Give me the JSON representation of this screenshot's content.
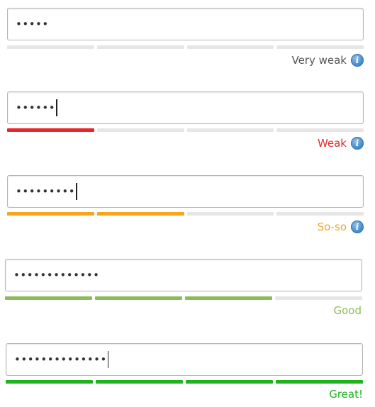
{
  "examples": [
    {
      "password_mask": "•••••",
      "has_caret": false,
      "segments_filled": 0,
      "fill_color": "#e6e6e6",
      "label": "Very weak",
      "label_color": "#555555",
      "has_info_icon": true
    },
    {
      "password_mask": "••••••",
      "has_caret": true,
      "segments_filled": 1,
      "fill_color": "#e8262a",
      "label": "Weak",
      "label_color": "#e8262a",
      "has_info_icon": true
    },
    {
      "password_mask": "•••••••••",
      "has_caret": true,
      "segments_filled": 2,
      "fill_color": "#f7a51c",
      "label": "So-so",
      "label_color": "#f7a51c",
      "has_info_icon": true
    },
    {
      "password_mask": "•••••••••••••",
      "has_caret": false,
      "segments_filled": 3,
      "fill_color": "#8dbb58",
      "label": "Good",
      "label_color": "#8dbb58",
      "has_info_icon": false
    },
    {
      "password_mask": "••••••••••••••",
      "has_caret": true,
      "segments_filled": 4,
      "fill_color": "#1eb41e",
      "label": "Great!",
      "label_color": "#1eb41e",
      "has_info_icon": false
    }
  ],
  "info_icon": {
    "name": "info-icon",
    "glyph": "i"
  },
  "segment_total": 4,
  "empty_segment_color": "#e6e6e6"
}
